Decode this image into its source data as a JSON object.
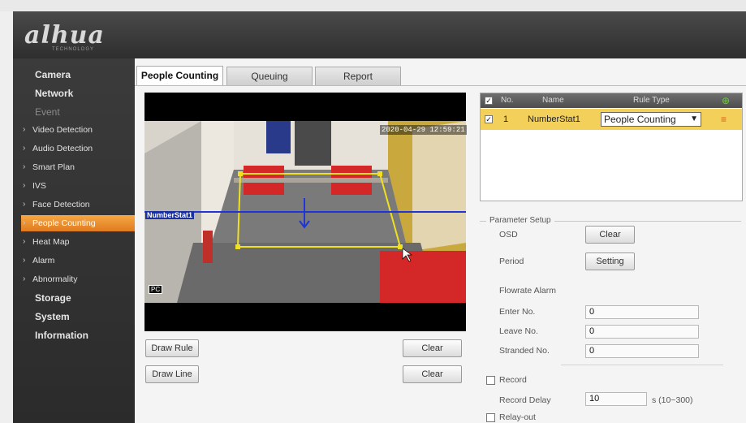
{
  "brand": {
    "logo": "alhua",
    "sub": "TECHNOLOGY"
  },
  "sidebar": {
    "items": [
      {
        "label": "Camera"
      },
      {
        "label": "Network"
      },
      {
        "label": "Event"
      },
      {
        "label": "Video Detection"
      },
      {
        "label": "Audio Detection"
      },
      {
        "label": "Smart Plan"
      },
      {
        "label": "IVS"
      },
      {
        "label": "Face Detection"
      },
      {
        "label": "People Counting"
      },
      {
        "label": "Heat Map"
      },
      {
        "label": "Alarm"
      },
      {
        "label": "Abnormality"
      },
      {
        "label": "Storage"
      },
      {
        "label": "System"
      },
      {
        "label": "Information"
      }
    ]
  },
  "tabs": [
    {
      "label": "People Counting"
    },
    {
      "label": "Queuing"
    },
    {
      "label": "Report"
    }
  ],
  "video": {
    "timestamp": "2020-04-29 12:59:21",
    "rule_label": "NumberStat1",
    "badge": "PC"
  },
  "buttons": {
    "draw_rule": "Draw Rule",
    "draw_line": "Draw Line",
    "clear_rule": "Clear",
    "clear_line": "Clear"
  },
  "rule_table": {
    "headers": {
      "no": "No.",
      "name": "Name",
      "rule_type": "Rule Type"
    },
    "rows": [
      {
        "no": "1",
        "name": "NumberStat1",
        "rule_type": "People Counting",
        "checked": true
      }
    ]
  },
  "parameters": {
    "title": "Parameter Setup",
    "osd_label": "OSD",
    "osd_button": "Clear",
    "period_label": "Period",
    "period_button": "Setting",
    "flowrate_label": "Flowrate Alarm",
    "enter_label": "Enter No.",
    "enter_value": "0",
    "leave_label": "Leave No.",
    "leave_value": "0",
    "stranded_label": "Stranded No.",
    "stranded_value": "0",
    "record_label": "Record",
    "record_delay_label": "Record Delay",
    "record_delay_value": "10",
    "record_delay_unit": "s (10~300)",
    "relay_label": "Relay-out"
  },
  "colors": {
    "accent": "#e88a2a",
    "rule_row": "#f3d05a",
    "header_bg": "#3a3a3a",
    "rule_line": "#1f35d6",
    "region": "#f0e020"
  }
}
